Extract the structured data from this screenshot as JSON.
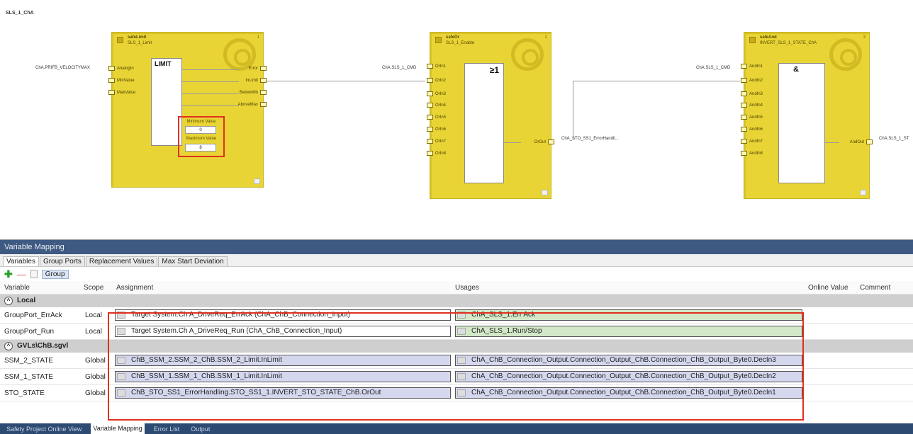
{
  "diagram": {
    "title": "SLS_1_ChA",
    "block1": {
      "type": "safeLimit",
      "instance": "SLS_1_Limit",
      "num": "1",
      "symbol": "LIMIT",
      "inputs": [
        "AnalogIn",
        "MinValue",
        "MaxValue"
      ],
      "outputs": [
        "Error",
        "InLimit",
        "BelowMin",
        "AboveMax"
      ],
      "ext_input": "ChA.PRIFB_VELOCITYMAX",
      "param_min_label": "Minimum Value",
      "param_min_value": "0",
      "param_max_label": "Maximum Value",
      "param_max_value": "8"
    },
    "block2": {
      "type": "safeOr",
      "instance": "SLS_1_Enable",
      "num": "2",
      "symbol": "≥1",
      "inputs": [
        "OrIn1",
        "OrIn2",
        "OrIn3",
        "OrIn4",
        "OrIn5",
        "OrIn6",
        "OrIn7",
        "OrIn8"
      ],
      "output": "OrOut",
      "ext_input": "ChA.SLS_1_CMD",
      "ext_output": "ChA_STO_SS1_ErrorHandli..."
    },
    "block3": {
      "type": "safeAnd",
      "instance": "INVERT_SLS_1_STATE_ChA",
      "num": "3",
      "symbol": "&",
      "inputs": [
        "AndIn1",
        "AndIn2",
        "AndIn3",
        "AndIn4",
        "AndIn5",
        "AndIn6",
        "AndIn7",
        "AndIn8"
      ],
      "output": "AndOut",
      "ext_input": "ChA.SLS_1_CMD",
      "ext_output": "ChA.SLS_1_ST"
    }
  },
  "panel": {
    "title": "Variable Mapping",
    "tabs": [
      "Variables",
      "Group Ports",
      "Replacement Values",
      "Max Start Deviation"
    ],
    "toolbar_group": "Group",
    "columns": {
      "variable": "Variable",
      "scope": "Scope",
      "assignment": "Assignment",
      "usages": "Usages",
      "online": "Online Value",
      "comment": "Comment"
    },
    "groups": [
      {
        "name": "Local",
        "rows": [
          {
            "variable": "GroupPort_ErrAck",
            "scope": "Local",
            "assignment": "Target System.Ch A_DriveReq_ErrAck (ChA_ChB_Connection_Input)",
            "usage": "ChA_SLS_1.Err Ack"
          },
          {
            "variable": "GroupPort_Run",
            "scope": "Local",
            "assignment": "Target System.Ch A_DriveReq_Run (ChA_ChB_Connection_Input)",
            "usage": "ChA_SLS_1.Run/Stop"
          }
        ]
      },
      {
        "name": "GVLs\\ChB.sgvl",
        "rows": [
          {
            "variable": "SSM_2_STATE",
            "scope": "Global",
            "assignment": "ChB_SSM_2.SSM_2_ChB.SSM_2_Limit.InLimit",
            "usage": "ChA_ChB_Connection_Output.Connection_Output_ChB.Connection_ChB_Output_Byte0.DecIn3"
          },
          {
            "variable": "SSM_1_STATE",
            "scope": "Global",
            "assignment": "ChB_SSM_1.SSM_1_ChB.SSM_1_Limit.InLimit",
            "usage": "ChA_ChB_Connection_Output.Connection_Output_ChB.Connection_ChB_Output_Byte0.DecIn2"
          },
          {
            "variable": "STO_STATE",
            "scope": "Global",
            "assignment": "ChB_STO_SS1_ErrorHandling.STO_SS1_1.INVERT_STO_STATE_ChB.OrOut",
            "usage": "ChA_ChB_Connection_Output.Connection_Output_ChB.Connection_ChB_Output_Byte0.DecIn1"
          }
        ]
      }
    ]
  },
  "statusbar": {
    "tabs": [
      "Safety Project Online View",
      "Variable Mapping",
      "Error List",
      "Output"
    ],
    "active": "Variable Mapping"
  },
  "colors": {
    "fb_yellow": "#e9d435",
    "highlight_red": "#e0301e",
    "panel_title_bg": "#3f5a82",
    "usage_green": "#d3e8c8",
    "assignment_blue": "#d5d7ee"
  }
}
